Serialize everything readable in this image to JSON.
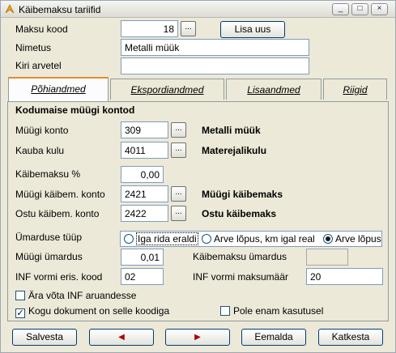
{
  "window": {
    "title": "Käibemaksu tariifid",
    "controls": {
      "minimize": "_",
      "restore": "□",
      "close": "×"
    }
  },
  "header_fields": {
    "code_label": "Maksu kood",
    "code_value": "18",
    "code_lookup": "...",
    "add_new": "Lisa uus",
    "name_label": "Nimetus",
    "name_value": "Metalli müük",
    "invoice_label": "Kiri arvetel",
    "invoice_value": ""
  },
  "tabs": [
    {
      "label": "Põhiandmed",
      "active": true
    },
    {
      "label": "Ekspordiandmed",
      "active": false
    },
    {
      "label": "Lisaandmed",
      "active": false
    },
    {
      "label": "Riigid",
      "active": false
    }
  ],
  "domestic": {
    "section_title": "Kodumaise müügi kontod",
    "sales_account_label": "Müügi konto",
    "sales_account_value": "309",
    "sales_account_name": "Metalli müük",
    "cost_account_label": "Kauba kulu",
    "cost_account_value": "4011",
    "cost_account_name": "Materejalikulu",
    "vat_percent_label": "Käibemaksu %",
    "vat_percent_value": "0,00",
    "sales_vat_label": "Müügi käibem. konto",
    "sales_vat_value": "2421",
    "sales_vat_name": "Müügi käibemaks",
    "purchase_vat_label": "Ostu käibem. konto",
    "purchase_vat_value": "2422",
    "purchase_vat_name": "Ostu käibemaks",
    "lookup": "..."
  },
  "rounding": {
    "type_label": "Ümarduse tüüp",
    "options": [
      "Iga rida eraldi",
      "Arve lõpus, km igal real",
      "Arve lõpus"
    ],
    "selected": "Arve lõpus",
    "sales_rounding_label": "Müügi ümardus",
    "sales_rounding_value": "0,01",
    "vat_rounding_label": "Käibemaksu ümardus",
    "vat_rounding_value": ""
  },
  "inf": {
    "special_code_label": "INF vormi eris. kood",
    "special_code_value": "02",
    "tax_rate_label": "INF vormi maksumäär",
    "tax_rate_value": "20"
  },
  "checkboxes": {
    "exclude_inf": {
      "label": "Ära võta INF aruandesse",
      "checked": false
    },
    "whole_document": {
      "label": "Kogu dokument on selle koodiga",
      "checked": true
    },
    "not_in_use": {
      "label": "Pole enam kasutusel",
      "checked": false
    }
  },
  "footer": {
    "save": "Salvesta",
    "prev": "◀",
    "next": "▶",
    "delete": "Eemalda",
    "cancel": "Katkesta"
  },
  "colors": {
    "tab_highlight": "#e68b2c",
    "window_bg": "#ece9d8",
    "field_border": "#7f9db9"
  }
}
